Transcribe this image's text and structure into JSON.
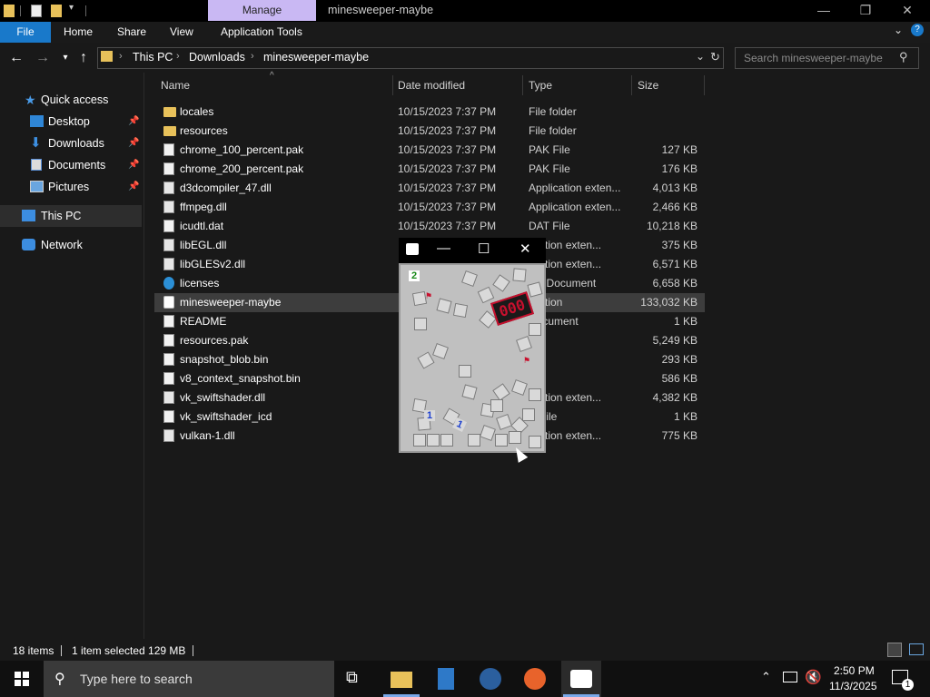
{
  "titlebar": {
    "manage_label": "Manage",
    "window_title": "minesweeper-maybe",
    "minimize_icon": "minimize-icon",
    "maximize_icon": "restore-icon",
    "close_icon": "close-icon"
  },
  "ribbon": {
    "tabs": [
      "File",
      "Home",
      "Share",
      "View",
      "Application Tools"
    ]
  },
  "address": {
    "crumbs": [
      "This PC",
      "Downloads",
      "minesweeper-maybe"
    ],
    "search_placeholder": "Search minesweeper-maybe"
  },
  "nav": {
    "items": [
      {
        "label": "Quick access",
        "icon": "star-icon"
      },
      {
        "label": "Desktop",
        "icon": "desktop-icon",
        "pinned": true
      },
      {
        "label": "Downloads",
        "icon": "download-icon",
        "pinned": true
      },
      {
        "label": "Documents",
        "icon": "documents-icon",
        "pinned": true
      },
      {
        "label": "Pictures",
        "icon": "pictures-icon",
        "pinned": true
      },
      {
        "label": "This PC",
        "icon": "computer-icon"
      },
      {
        "label": "Network",
        "icon": "network-icon"
      }
    ]
  },
  "columns": {
    "name": "Name",
    "date": "Date modified",
    "type": "Type",
    "size": "Size"
  },
  "files": [
    {
      "name": "locales",
      "date": "10/15/2023 7:37 PM",
      "type": "File folder",
      "size": "",
      "icon": "folder-icon"
    },
    {
      "name": "resources",
      "date": "10/15/2023 7:37 PM",
      "type": "File folder",
      "size": "",
      "icon": "folder-icon"
    },
    {
      "name": "chrome_100_percent.pak",
      "date": "10/15/2023 7:37 PM",
      "type": "PAK File",
      "size": "127 KB",
      "icon": "file-icon"
    },
    {
      "name": "chrome_200_percent.pak",
      "date": "10/15/2023 7:37 PM",
      "type": "PAK File",
      "size": "176 KB",
      "icon": "file-icon"
    },
    {
      "name": "d3dcompiler_47.dll",
      "date": "10/15/2023 7:37 PM",
      "type": "Application exten...",
      "size": "4,013 KB",
      "icon": "dll-icon"
    },
    {
      "name": "ffmpeg.dll",
      "date": "10/15/2023 7:37 PM",
      "type": "Application exten...",
      "size": "2,466 KB",
      "icon": "dll-icon"
    },
    {
      "name": "icudtl.dat",
      "date": "10/15/2023 7:37 PM",
      "type": "DAT File",
      "size": "10,218 KB",
      "icon": "file-icon"
    },
    {
      "name": "libEGL.dll",
      "date": "",
      "type": "lication exten...",
      "size": "375 KB",
      "icon": "dll-icon"
    },
    {
      "name": "libGLESv2.dll",
      "date": "",
      "type": "lication exten...",
      "size": "6,571 KB",
      "icon": "dll-icon"
    },
    {
      "name": "licenses",
      "date": "",
      "type": "ML Document",
      "size": "6,658 KB",
      "icon": "edge-icon"
    },
    {
      "name": "minesweeper-maybe",
      "date": "",
      "type": "lication",
      "size": "133,032 KB",
      "icon": "app-icon",
      "selected": true
    },
    {
      "name": "README",
      "date": "",
      "type": "Document",
      "size": "1 KB",
      "icon": "text-icon"
    },
    {
      "name": "resources.pak",
      "date": "",
      "type": "File",
      "size": "5,249 KB",
      "icon": "file-icon"
    },
    {
      "name": "snapshot_blob.bin",
      "date": "",
      "type": "File",
      "size": "293 KB",
      "icon": "file-icon"
    },
    {
      "name": "v8_context_snapshot.bin",
      "date": "",
      "type": "File",
      "size": "586 KB",
      "icon": "file-icon"
    },
    {
      "name": "vk_swiftshader.dll",
      "date": "",
      "type": "lication exten...",
      "size": "4,382 KB",
      "icon": "dll-icon"
    },
    {
      "name": "vk_swiftshader_icd",
      "date": "",
      "type": "N File",
      "size": "1 KB",
      "icon": "json-icon"
    },
    {
      "name": "vulkan-1.dll",
      "date": "",
      "type": "lication exten...",
      "size": "775 KB",
      "icon": "dll-icon"
    }
  ],
  "status": {
    "count": "18 items",
    "selection": "1 item selected  129 MB"
  },
  "game": {
    "title_icon": "game-logo-icon",
    "counter": "000",
    "counter_color": "#c8102e",
    "number_tiles": [
      "2",
      "1",
      "1"
    ]
  },
  "taskbar": {
    "search_placeholder": "Type here to search",
    "time": "2:50 PM",
    "date": "11/3/2025",
    "notification_count": "1"
  },
  "colors": {
    "accent": "#1979ca",
    "manage_tab": "#c9b8f3",
    "folder": "#e8c15a"
  }
}
